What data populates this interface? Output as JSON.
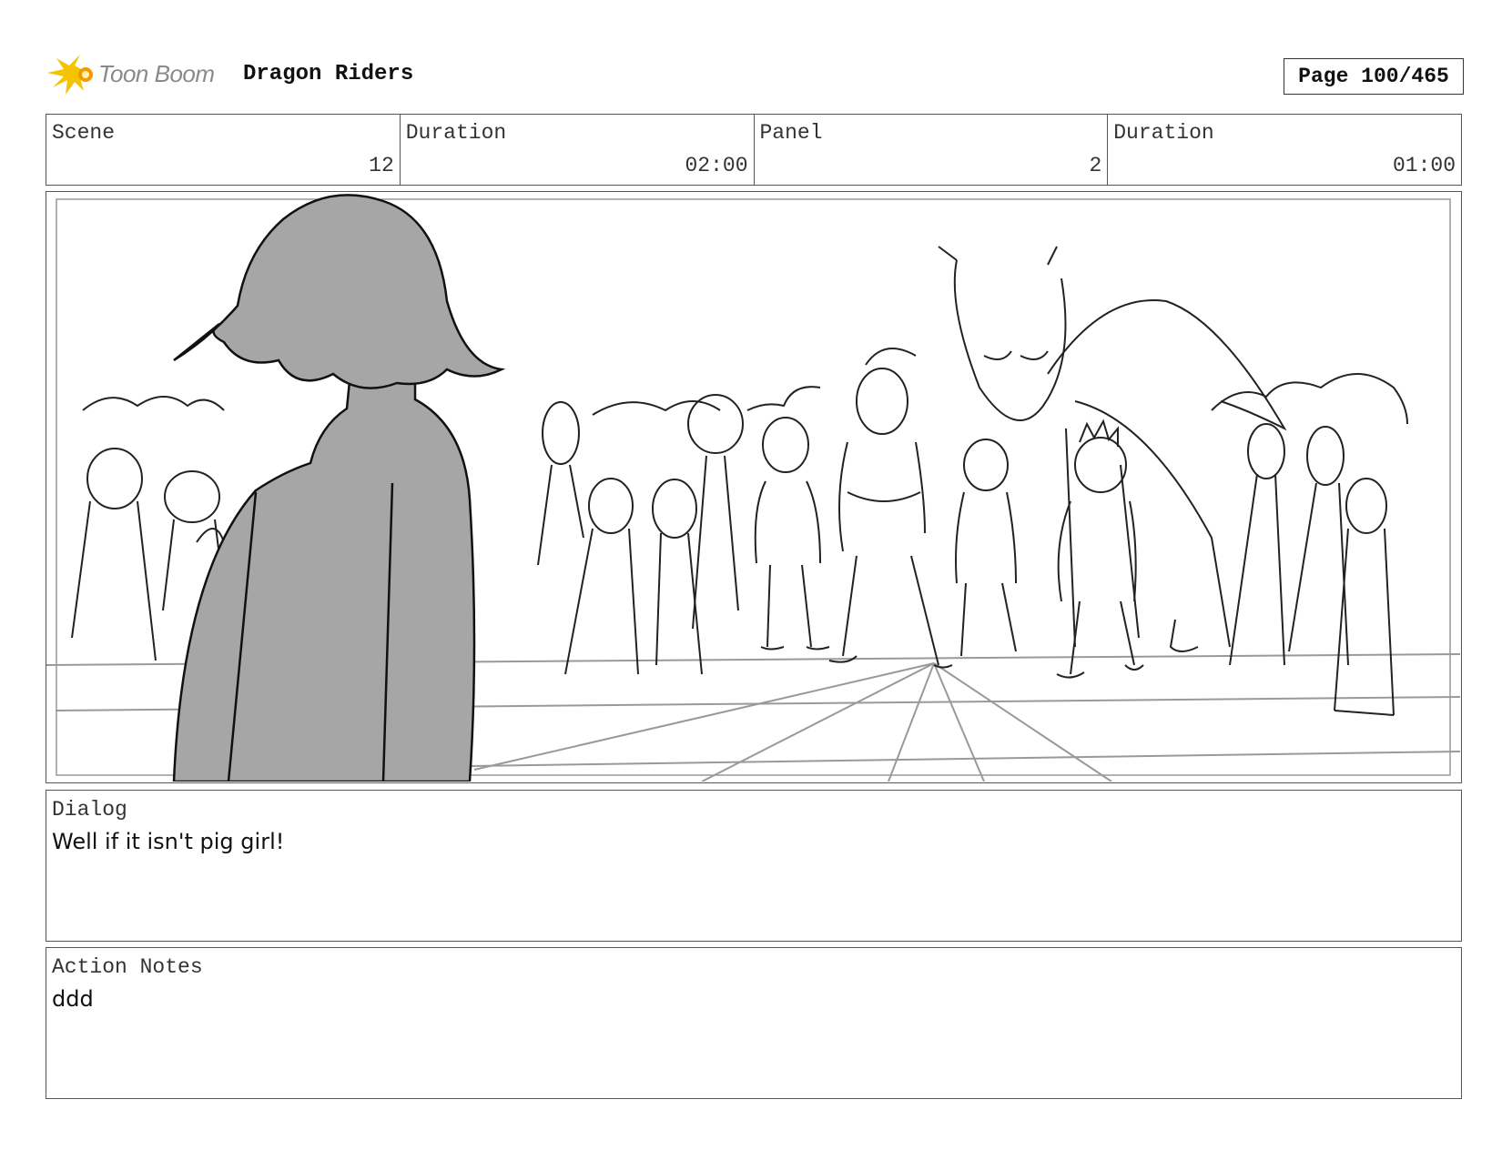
{
  "header": {
    "logo_text": "Toon Boom",
    "project_title": "Dragon Riders",
    "page_label": "Page 100/465"
  },
  "info": {
    "scene_label": "Scene",
    "scene_value": "12",
    "scene_duration_label": "Duration",
    "scene_duration_value": "02:00",
    "panel_label": "Panel",
    "panel_value": "2",
    "panel_duration_label": "Duration",
    "panel_duration_value": "01:00"
  },
  "dialog": {
    "label": "Dialog",
    "text": "Well if it isn't pig girl!"
  },
  "action_notes": {
    "label": "Action Notes",
    "text": "ddd"
  },
  "colors": {
    "logo_yellow": "#f5c400",
    "logo_orange": "#f29a00",
    "sketch_fill": "#a6a6a6",
    "border": "#555555"
  }
}
